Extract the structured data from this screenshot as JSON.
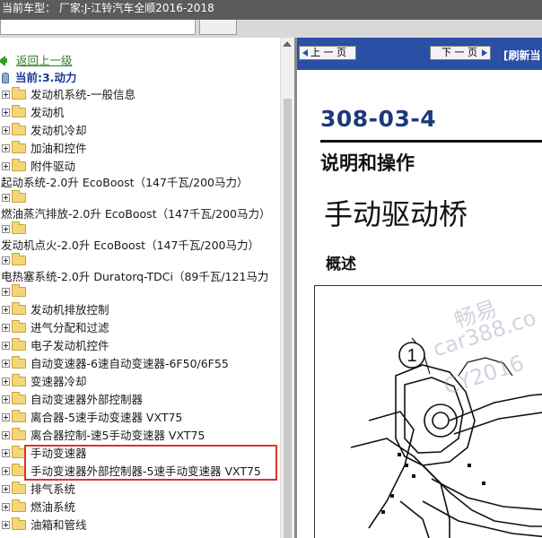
{
  "window": {
    "title": "当前车型： 厂家:J-江铃汽车全顺2016-2018"
  },
  "tree": {
    "back_label": "返回上一级",
    "current_label": "当前:3.动力",
    "items": [
      {
        "label": "发动机系统-一般信息",
        "type": "folder"
      },
      {
        "label": "发动机",
        "type": "folder"
      },
      {
        "label": "发动机冷却",
        "type": "folder"
      },
      {
        "label": "加油和控件",
        "type": "folder"
      },
      {
        "label": "附件驱动",
        "type": "folder"
      },
      {
        "label": "起动系统-2.0升 EcoBoost（147千瓦/200马力）",
        "type": "wrapped"
      },
      {
        "label": "燃油蒸汽排放-2.0升 EcoBoost（147千瓦/200马力）",
        "type": "wrapped"
      },
      {
        "label": "发动机点火-2.0升 EcoBoost（147千瓦/200马力）",
        "type": "wrapped"
      },
      {
        "label": "电热塞系统-2.0升 Duratorq-TDCi（89千瓦/121马力",
        "type": "wrapped-cut"
      },
      {
        "label": "发动机排放控制",
        "type": "folder"
      },
      {
        "label": "进气分配和过滤",
        "type": "folder"
      },
      {
        "label": "电子发动机控件",
        "type": "folder"
      },
      {
        "label": "自动变速器-6速自动变速器-6F50/6F55",
        "type": "folder"
      },
      {
        "label": "变速器冷却",
        "type": "folder"
      },
      {
        "label": "自动变速器外部控制器",
        "type": "folder"
      },
      {
        "label": "离合器-5速手动变速器 VXT75",
        "type": "folder"
      },
      {
        "label": "离合器控制-速5手动变速器 VXT75",
        "type": "folder"
      },
      {
        "label": "手动变速器",
        "type": "folder"
      },
      {
        "label": "手动变速器外部控制器-5速手动变速器 VXT75",
        "type": "folder"
      },
      {
        "label": "排气系统",
        "type": "folder"
      },
      {
        "label": "燃油系统",
        "type": "folder"
      },
      {
        "label": "油箱和管线",
        "type": "folder"
      }
    ]
  },
  "viewer": {
    "prev_label": "上 一 页",
    "next_label": "下 一 页",
    "refresh_label": "[刷新当",
    "doc_number": "308-03-4",
    "section_title": "说明和操作",
    "page_title": "手动驱动桥",
    "subsection": "概述",
    "callout": "1",
    "watermark": [
      "畅易",
      "car388.co",
      "CY2016"
    ]
  },
  "colors": {
    "nav_bar": "#2a50a6",
    "highlight_border": "#d9342b",
    "doc_number": "#1c3a7a",
    "back_link": "#2e7d2e"
  }
}
